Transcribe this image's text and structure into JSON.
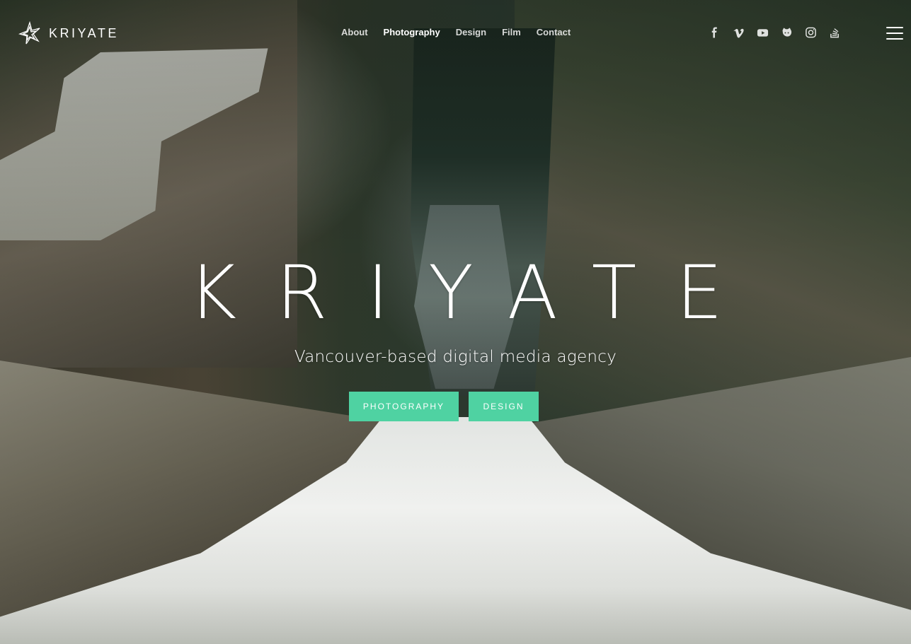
{
  "brand": {
    "logo_text": "KRIYATE",
    "logo_icon": "star-burst-logo"
  },
  "nav": {
    "items": [
      {
        "label": "About",
        "active": false
      },
      {
        "label": "Photography",
        "active": true
      },
      {
        "label": "Design",
        "active": false
      },
      {
        "label": "Film",
        "active": false
      },
      {
        "label": "Contact",
        "active": false
      }
    ]
  },
  "social": {
    "icons": [
      "facebook-icon",
      "vimeo-icon",
      "youtube-icon",
      "github-icon",
      "instagram-icon",
      "stack-overflow-icon"
    ]
  },
  "menu": {
    "icon": "hamburger-menu-icon"
  },
  "hero": {
    "title": "KRIYATE",
    "tagline": "Vancouver-based digital media agency",
    "buttons": [
      {
        "label": "PHOTOGRAPHY"
      },
      {
        "label": "DESIGN"
      }
    ]
  },
  "colors": {
    "accent": "#4fd2a2",
    "text": "#ffffff"
  }
}
